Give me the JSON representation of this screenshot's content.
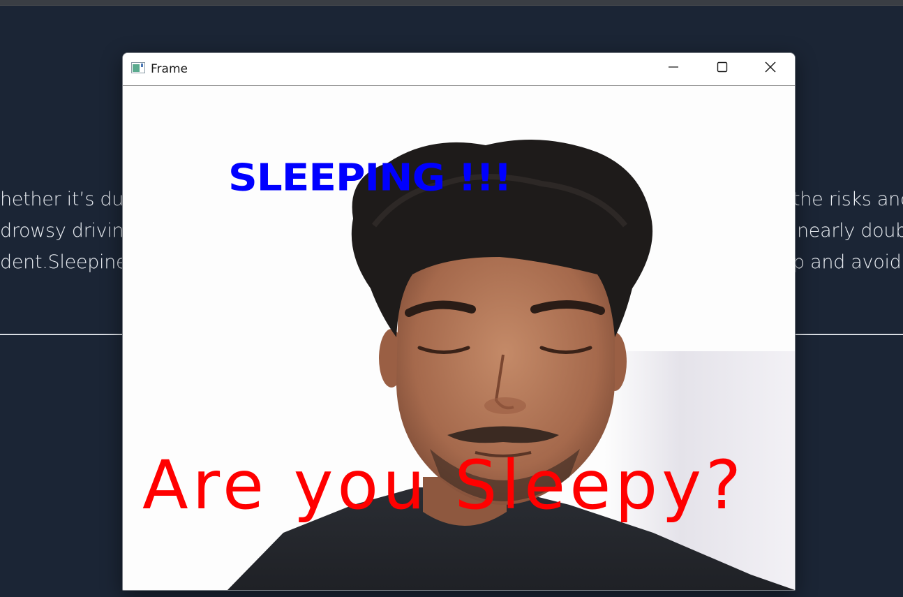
{
  "background": {
    "left_lines": [
      "hether it’s due t",
      "drowsy driving.",
      "dent.Sleepines"
    ],
    "right_lines": [
      "the risks and",
      "nearly doub",
      "p and avoid d"
    ]
  },
  "window": {
    "title": "Frame",
    "icon": "opencv-window-icon",
    "controls": {
      "minimize": "minimize-icon",
      "maximize": "maximize-icon",
      "close": "close-icon"
    }
  },
  "frame": {
    "status_text": "SLEEPING !!!",
    "prompt_text": "Are you Sleepy?",
    "status_color": "#0000ff",
    "prompt_color": "#ff0000"
  }
}
